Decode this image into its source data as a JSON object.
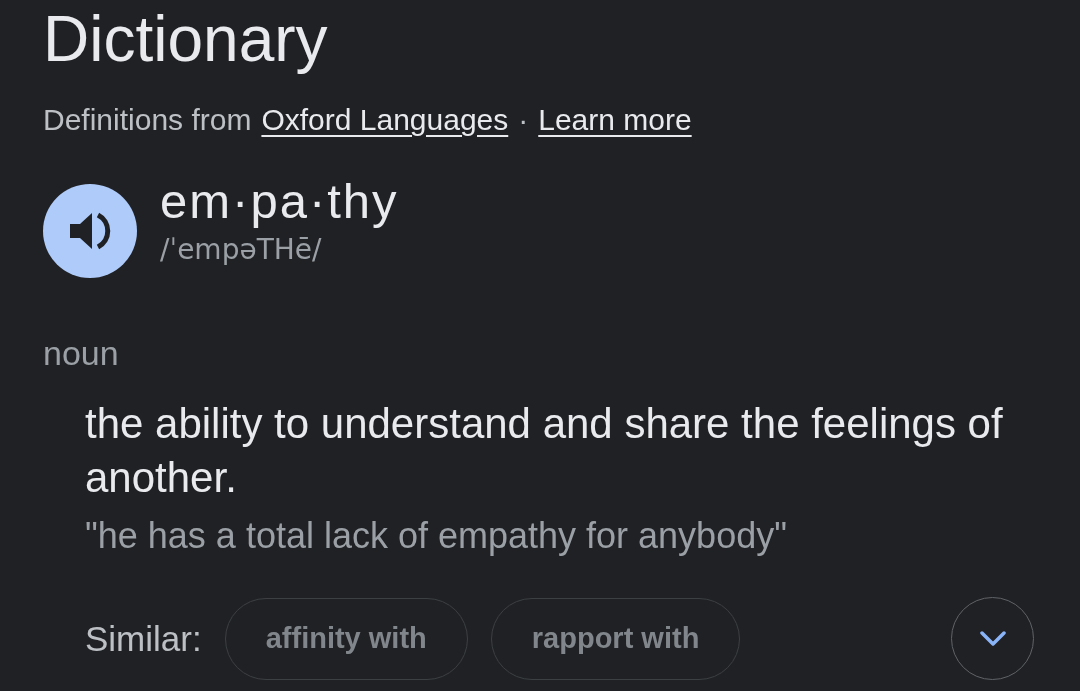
{
  "header": {
    "title": "Dictionary",
    "source_prefix": "Definitions from",
    "source_link": "Oxford Languages",
    "separator": "·",
    "learn_more": "Learn more"
  },
  "entry": {
    "word": "em·pa·thy",
    "pronunciation": "/ˈempəTHē/"
  },
  "senses": [
    {
      "part_of_speech": "noun",
      "definitions": [
        {
          "text": "the ability to understand and share the feelings of another.",
          "example": "\"he has a total lack of empathy for anybody\"",
          "similar_label": "Similar:",
          "similar": [
            "affinity with",
            "rapport with"
          ]
        }
      ]
    }
  ]
}
